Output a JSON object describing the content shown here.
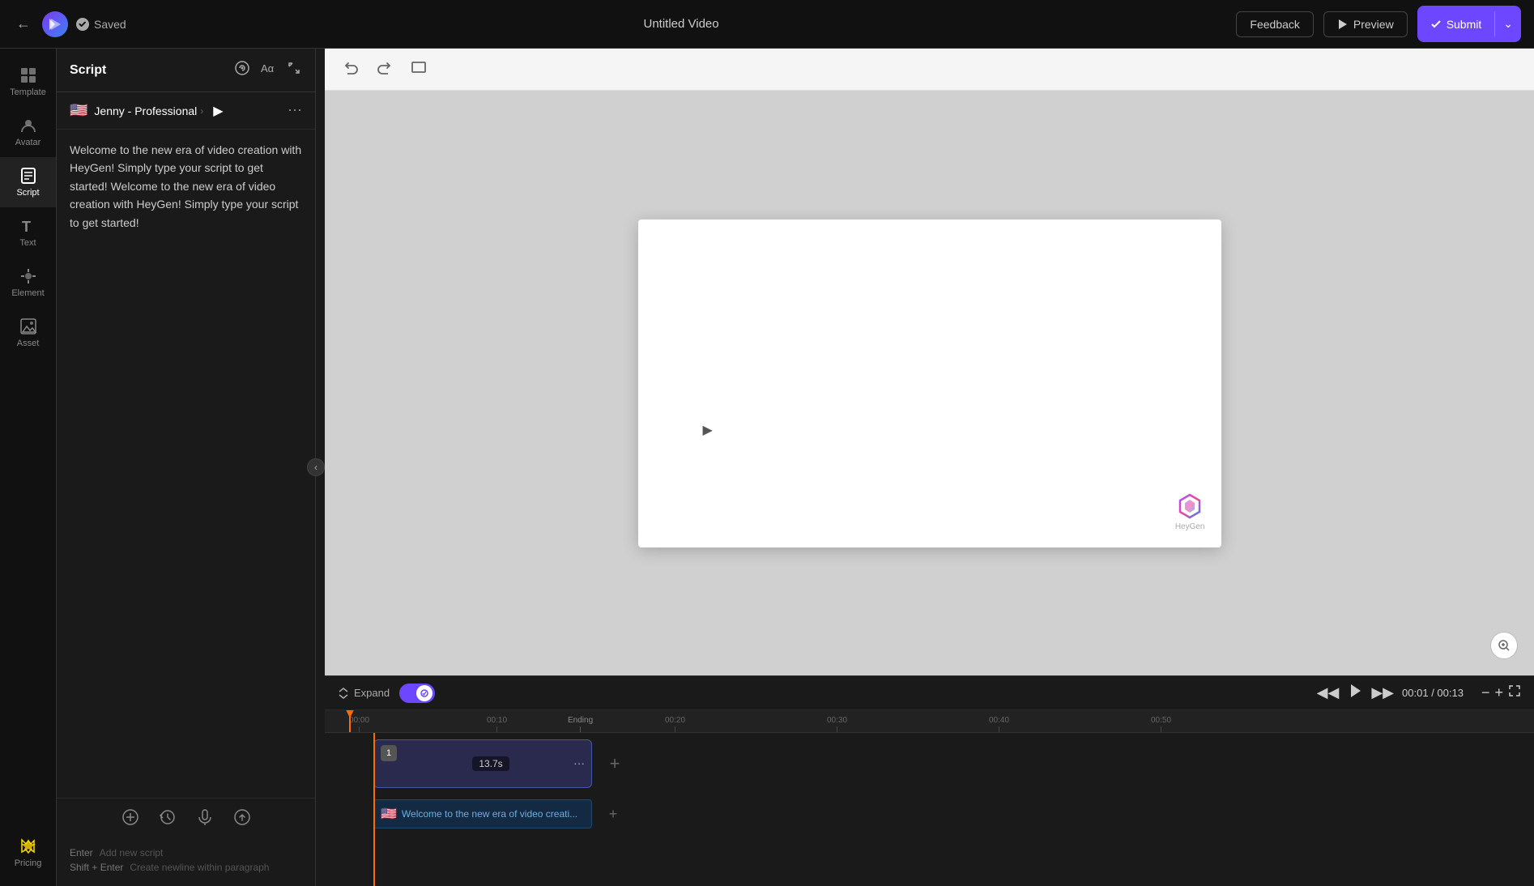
{
  "topbar": {
    "back_label": "←",
    "saved_label": "Saved",
    "title": "Untitled Video",
    "feedback_label": "Feedback",
    "preview_label": "Preview",
    "submit_label": "Submit"
  },
  "sidebar": {
    "items": [
      {
        "id": "template",
        "label": "Template",
        "icon": "grid"
      },
      {
        "id": "avatar",
        "label": "Avatar",
        "icon": "person-circle"
      },
      {
        "id": "script",
        "label": "Script",
        "icon": "document-text",
        "active": true
      },
      {
        "id": "text",
        "label": "Text",
        "icon": "text-format"
      },
      {
        "id": "element",
        "label": "Element",
        "icon": "element"
      },
      {
        "id": "asset",
        "label": "Asset",
        "icon": "asset"
      }
    ],
    "pricing": {
      "label": "Pricing"
    }
  },
  "script_panel": {
    "title": "Script",
    "avatar": {
      "flag": "🇺🇸",
      "name": "Jenny - Professional"
    },
    "script_text": "Welcome to the new era of video creation with HeyGen! Simply type your script to get started! Welcome to the new era of video creation with HeyGen! Simply type your script to get started!",
    "hints": [
      {
        "key": "Enter",
        "desc": "Add new script"
      },
      {
        "key": "Shift + Enter",
        "desc": "Create newline within paragraph"
      }
    ]
  },
  "canvas": {
    "undo_label": "↩",
    "redo_label": "↪",
    "fit_label": "⊡",
    "watermark": "HeyGen",
    "zoom_icon": "🔍"
  },
  "timeline": {
    "expand_label": "Expand",
    "time_current": "00:01",
    "time_total": "00:13",
    "scene": {
      "number": "1",
      "duration": "13.7s"
    },
    "subtitle_text": "Welcome to the new era of video creati...",
    "ruler_marks": [
      "00:00",
      "00:10",
      "Ending",
      "00:20",
      "00:30",
      "00:40",
      "00:50"
    ]
  }
}
